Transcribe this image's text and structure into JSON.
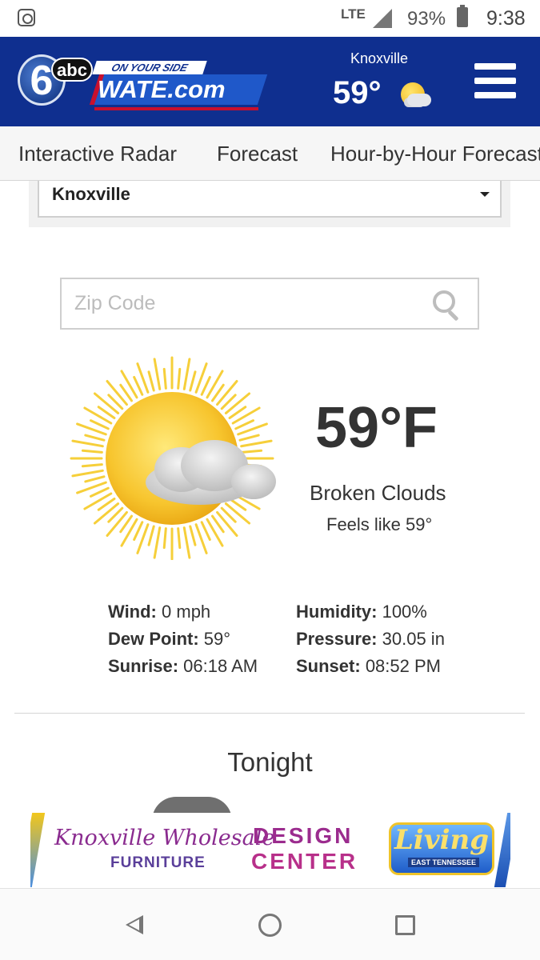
{
  "status_bar": {
    "network": "LTE",
    "battery": "93%",
    "time": "9:38"
  },
  "header": {
    "logo": {
      "channel": "6",
      "network": "abc",
      "tagline": "ON YOUR SIDE",
      "site": "WATE.com"
    },
    "city": "Knoxville",
    "temp": "59°"
  },
  "nav": {
    "tabs": [
      "Interactive Radar",
      "Forecast",
      "Hour-by-Hour Forecast"
    ]
  },
  "location": {
    "selected": "Knoxville"
  },
  "search": {
    "placeholder": "Zip Code"
  },
  "current": {
    "temp": "59°F",
    "condition": "Broken Clouds",
    "feels_like": "Feels like 59°",
    "icon": "sun-with-cloud-icon"
  },
  "stats": {
    "wind_label": "Wind:",
    "wind": "0 mph",
    "humidity_label": "Humidity:",
    "humidity": "100%",
    "dew_label": "Dew Point:",
    "dew": "59°",
    "pressure_label": "Pressure:",
    "pressure": "30.05 in",
    "sunrise_label": "Sunrise:",
    "sunrise": "06:18 AM",
    "sunset_label": "Sunset:",
    "sunset": "08:52 PM"
  },
  "tonight": {
    "heading": "Tonight"
  },
  "ad": {
    "brand": "Knoxville Wholesale",
    "furniture": "FURNITURE",
    "design": "DESIGN",
    "center": "CENTER",
    "living": "Living",
    "living_sub": "EAST TENNESSEE"
  },
  "colors": {
    "header_bg": "#0f2f8f",
    "nav_bg": "#f6f6f6",
    "text": "#333333"
  }
}
